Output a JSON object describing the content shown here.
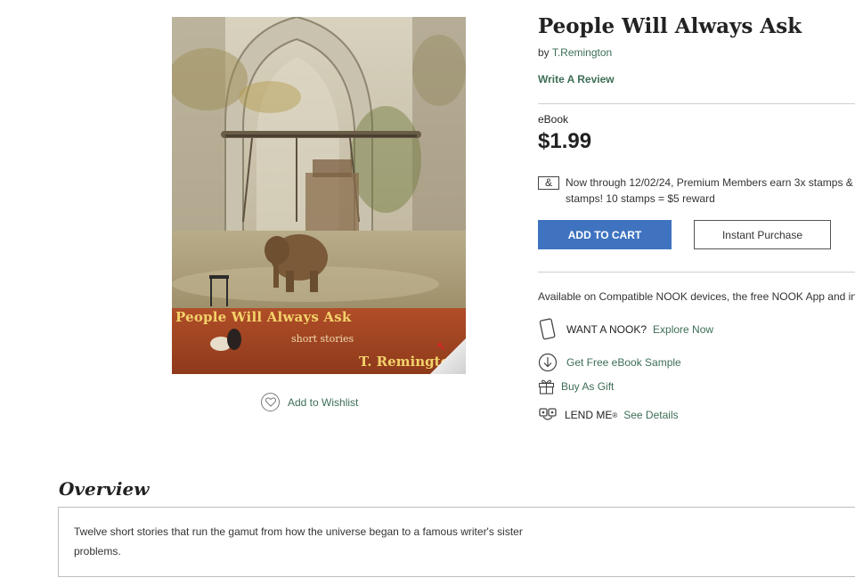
{
  "product": {
    "title": "People Will Always Ask",
    "by_prefix": "by",
    "author": "T.Remington",
    "write_review": "Write A Review",
    "format": "eBook",
    "price": "$1.99"
  },
  "cover": {
    "title": "People Will Always Ask",
    "subtitle": "short stories",
    "author": "T. Remington"
  },
  "promo": {
    "icon_char": "&",
    "line1": "Now through 12/02/24, Premium Members earn 3x stamps &",
    "line2": "stamps! 10 stamps = $5 reward"
  },
  "actions": {
    "add_to_cart": "ADD TO CART",
    "instant_purchase": "Instant Purchase",
    "wishlist": "Add to Wishlist"
  },
  "availability": "Available on Compatible NOOK devices, the free NOOK App and in",
  "links": {
    "want_nook": "WANT A NOOK?",
    "explore_now": "Explore Now",
    "free_sample": "Get Free eBook Sample",
    "buy_as_gift": "Buy As Gift",
    "lend_me": "LEND ME",
    "lend_me_mark": "®",
    "see_details": "See Details"
  },
  "overview": {
    "heading": "Overview",
    "text_line1": "Twelve short stories that run the gamut from how the universe began to a famous writer's sister",
    "text_line2": "problems."
  },
  "colors": {
    "accent_green": "#3d6e56",
    "cart_blue": "#3f73c0"
  }
}
